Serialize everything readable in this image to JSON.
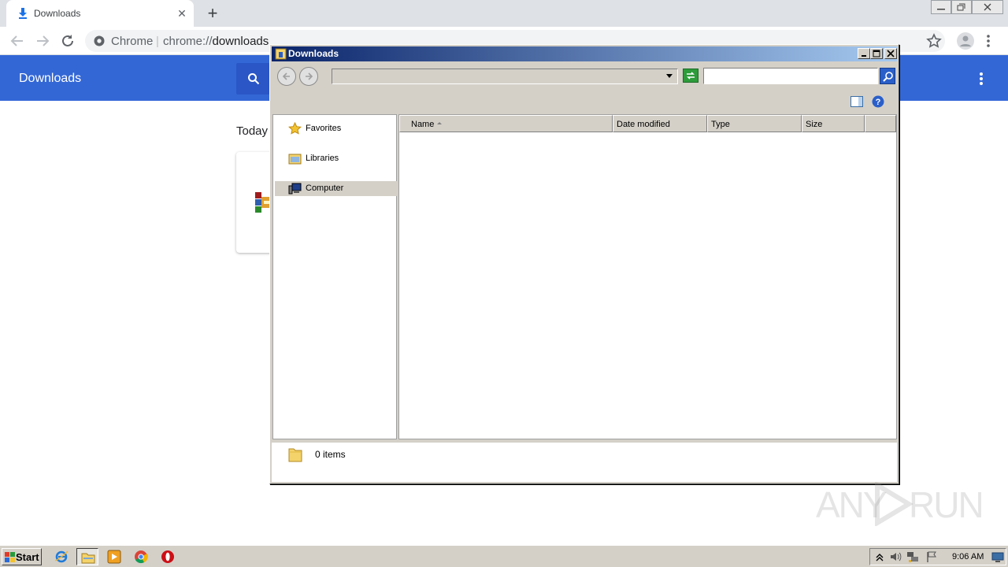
{
  "chrome": {
    "tab": {
      "title": "Downloads",
      "close_glyph": "✕"
    },
    "new_tab_glyph": "+",
    "omnibox": {
      "site_label": "Chrome",
      "separator": "|",
      "url_scheme": "chrome://",
      "url_host": "downloads"
    },
    "icons": [
      "download-icon",
      "back-arrow-icon",
      "forward-arrow-icon",
      "reload-icon",
      "chrome-icon",
      "star-icon",
      "profile-icon",
      "more-vert-icon",
      "search-icon"
    ]
  },
  "downloads_page": {
    "title": "Downloads",
    "date_section": "Today",
    "item_icon": "winrar-archive-icon"
  },
  "explorer": {
    "title": "Downloads",
    "address_value": "",
    "search_value": "",
    "nav_pane": [
      {
        "label": "Favorites",
        "icon": "star-icon"
      },
      {
        "label": "Libraries",
        "icon": "libraries-icon"
      },
      {
        "label": "Computer",
        "icon": "computer-icon",
        "selected": true
      }
    ],
    "columns": [
      "Name",
      "Date modified",
      "Type",
      "Size"
    ],
    "sorted_column": "Name",
    "items": [],
    "status": "0 items"
  },
  "watermark": {
    "left": "ANY",
    "right": "RUN"
  },
  "taskbar": {
    "start_label": "Start",
    "apps": [
      "internet-explorer-icon",
      "windows-explorer-icon",
      "media-player-icon",
      "chrome-icon",
      "opera-icon"
    ],
    "active_app": "windows-explorer-icon",
    "tray_icons": [
      "show-hidden-icons-icon",
      "volume-icon",
      "network-icon",
      "action-center-flag-icon",
      "show-desktop-icon"
    ],
    "clock": "9:06 AM"
  },
  "colors": {
    "chrome_blue_header": "#3367d6",
    "explorer_title_start": "#0a246a",
    "explorer_title_end": "#a6caf0",
    "classic_face": "#d4d0c8"
  }
}
